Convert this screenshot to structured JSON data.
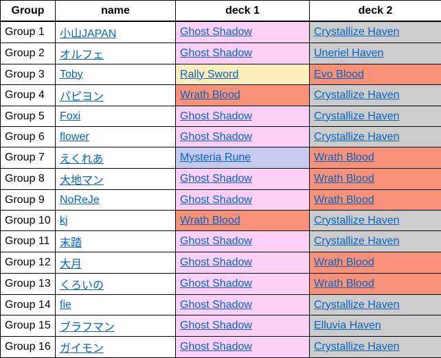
{
  "headers": {
    "group": "Group",
    "name": "name",
    "deck1": "deck 1",
    "deck2": "deck 2"
  },
  "deck_colors": {
    "Ghost Shadow": "bg-pink",
    "Rally Sword": "bg-yellow",
    "Wrath Blood": "bg-salmon",
    "Crystallize Haven": "bg-gray",
    "Uneriel Haven": "bg-gray",
    "Elluvia Haven": "bg-gray",
    "Evo Blood": "bg-salmon",
    "Mysteria Rune": "bg-purple"
  },
  "rows": [
    {
      "group": "Group 1",
      "name": "小山JAPAN",
      "deck1": "Ghost Shadow",
      "deck2": "Crystallize Haven"
    },
    {
      "group": "Group 2",
      "name": "オルフェ",
      "deck1": "Ghost Shadow",
      "deck2": "Uneriel Haven"
    },
    {
      "group": "Group 3",
      "name": "Toby",
      "deck1": "Rally Sword",
      "deck2": "Evo Blood"
    },
    {
      "group": "Group 4",
      "name": "パピヨン",
      "deck1": "Wrath Blood",
      "deck2": "Crystallize Haven"
    },
    {
      "group": "Group 5",
      "name": "Foxi",
      "deck1": "Ghost Shadow",
      "deck2": "Crystallize Haven"
    },
    {
      "group": "Group 6",
      "name": "flower",
      "deck1": "Ghost Shadow",
      "deck2": "Crystallize Haven"
    },
    {
      "group": "Group 7",
      "name": "えくれあ",
      "deck1": "Mysteria Rune",
      "deck2": "Wrath Blood"
    },
    {
      "group": "Group 8",
      "name": "大地マン",
      "deck1": "Ghost Shadow",
      "deck2": "Wrath Blood"
    },
    {
      "group": "Group 9",
      "name": "NoReJe",
      "deck1": "Ghost Shadow",
      "deck2": "Wrath Blood"
    },
    {
      "group": "Group 10",
      "name": "kj",
      "deck1": "Wrath Blood",
      "deck2": "Crystallize Haven"
    },
    {
      "group": "Group 11",
      "name": "末踏",
      "deck1": "Ghost Shadow",
      "deck2": "Crystallize Haven"
    },
    {
      "group": "Group 12",
      "name": "大月",
      "deck1": "Ghost Shadow",
      "deck2": "Wrath Blood"
    },
    {
      "group": "Group 13",
      "name": "くろいの",
      "deck1": "Ghost Shadow",
      "deck2": "Wrath Blood"
    },
    {
      "group": "Group 14",
      "name": "fie",
      "deck1": "Ghost Shadow",
      "deck2": "Crystallize Haven"
    },
    {
      "group": "Group 15",
      "name": "ブラフマン",
      "deck1": "Ghost Shadow",
      "deck2": "Elluvia Haven"
    },
    {
      "group": "Group 16",
      "name": "ガイモン",
      "deck1": "Ghost Shadow",
      "deck2": "Crystallize Haven"
    }
  ]
}
